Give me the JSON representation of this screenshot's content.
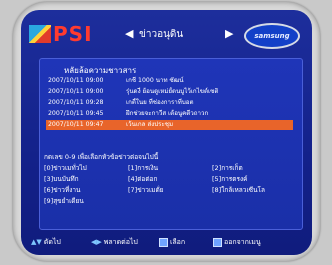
{
  "header": {
    "logo_text": "PSI",
    "nav_left": "◀",
    "nav_title": "ข่าวอนุดิน",
    "nav_right": "▶",
    "brand": "samsung"
  },
  "list": {
    "title": "หลัยล้อความชาวสาร",
    "rows": [
      {
        "datetime": "2007/10/11 09:00",
        "text": "เกชี 1000 นาท ซัฒน์"
      },
      {
        "datetime": "2007/10/11 09:00",
        "text": "รุ่นดงี่ ย้อนดูเหม่ยั้ดนบูไว้เกไขต์เซติ"
      },
      {
        "datetime": "2007/10/11 09:28",
        "text": "เกตี้ในย ที่ช่องการาที่บอต"
      },
      {
        "datetime": "2007/10/11 09:45",
        "text": "ฝึกช่วยจะกาวีส เต้อนูคตีวถาวก"
      },
      {
        "datetime": "2007/10/11 09:47",
        "text": "เว้นเกล ส่งประชุม"
      }
    ],
    "selected_index": 4
  },
  "hint": "กดเลข 0-9 เพื่อเลือกหัวข้อข่าวต่อจนไปนี้",
  "categories": [
    "[0]ข่าวเมทั่วไป",
    "[1]การเงิน",
    "[2]การเก็ต",
    "[3]บนบันทึก",
    "[4]ต่อต่อก",
    "[5]การตรงค์",
    "[6]ข่าวที่งาน",
    "[7]ข่าวเมตั่ย",
    "[8]ใกล้เหลวเซีนโล",
    "[9]สุขยำเดียน"
  ],
  "footer": {
    "item1_key": "▲▼",
    "item1_label": "ตัดไป",
    "item2_key": "◀▶",
    "item2_label": "พลาดต่อไป",
    "item3_label": "เลือก",
    "item4_label": "ออกจากเมนู"
  },
  "colors": {
    "screen_bg": "#13218a",
    "selected_row": "#e8642a",
    "logo_red": "#ff3b2f"
  }
}
